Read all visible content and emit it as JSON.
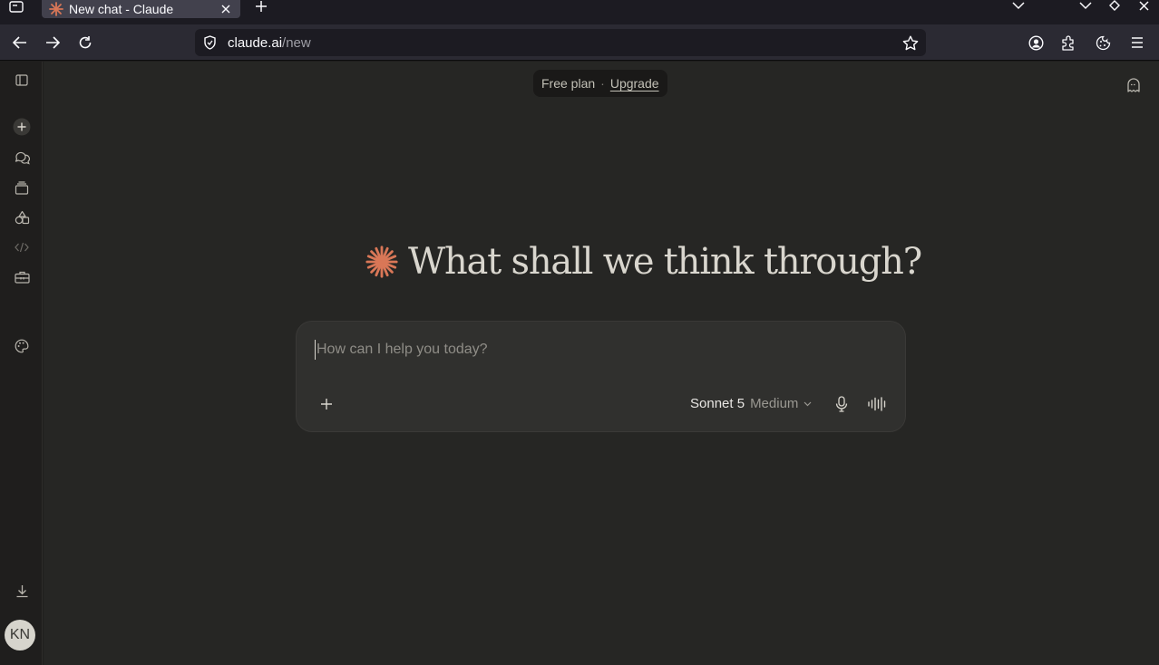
{
  "browser": {
    "tab_title": "New chat - Claude",
    "url_host": "claude.ai",
    "url_path": "/new"
  },
  "header": {
    "plan_label": "Free plan",
    "separator": "·",
    "upgrade_label": "Upgrade"
  },
  "greeting": {
    "text": "What shall we think through?"
  },
  "composer": {
    "placeholder": "How can I help you today?",
    "model_name": "Sonnet 5",
    "effort_label": "Medium"
  },
  "user": {
    "initials": "KN"
  },
  "colors": {
    "accent": "#d97757",
    "background": "#262624",
    "rail": "#1f1e1d",
    "composer": "#30302e"
  },
  "icons": {
    "rail": [
      "sidebar-toggle-icon",
      "new-chat-icon",
      "chats-icon",
      "projects-icon",
      "artifacts-icon",
      "code-icon",
      "toolbox-icon",
      "palette-icon",
      "download-icon"
    ],
    "header": [
      "incognito-ghost-icon"
    ],
    "composer": [
      "plus-icon",
      "chevron-down-icon",
      "microphone-icon",
      "voice-waveform-icon"
    ]
  }
}
